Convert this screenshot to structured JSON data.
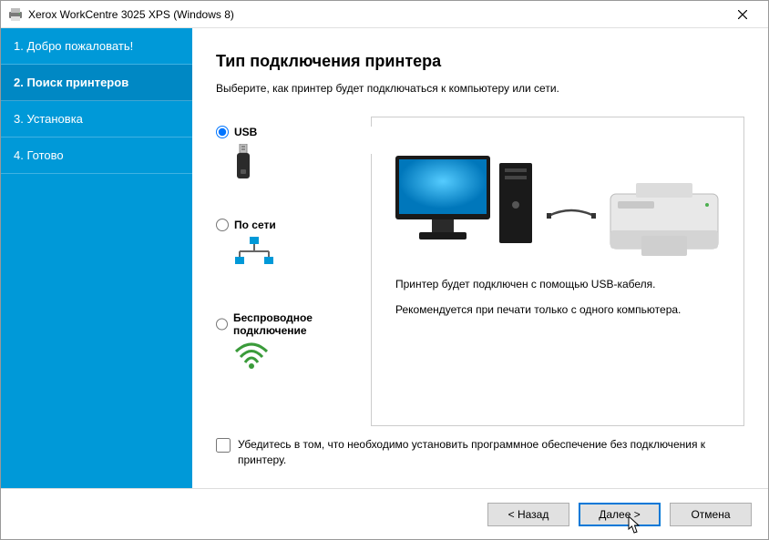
{
  "window": {
    "title": "Xerox WorkCentre 3025 XPS (Windows 8)"
  },
  "sidebar": {
    "items": [
      {
        "label": "1. Добро пожаловать!"
      },
      {
        "label": "2. Поиск принтеров"
      },
      {
        "label": "3. Установка"
      },
      {
        "label": "4. Готово"
      }
    ],
    "active_index": 1
  },
  "page": {
    "title": "Тип подключения принтера",
    "subtitle": "Выберите, как принтер будет подключаться к компьютеру или сети."
  },
  "options": {
    "usb": {
      "label": "USB",
      "selected": true
    },
    "network": {
      "label": "По сети",
      "selected": false
    },
    "wireless": {
      "label": "Беспроводное подключение",
      "selected": false
    }
  },
  "preview": {
    "line1": "Принтер будет подключен с помощью USB-кабеля.",
    "line2": "Рекомендуется при печати только с одного компьютера."
  },
  "checkbox": {
    "label": "Убедитесь в том, что необходимо установить программное обеспечение без подключения к принтеру.",
    "checked": false
  },
  "buttons": {
    "back": "< Назад",
    "next": "Далее >",
    "cancel": "Отмена"
  }
}
